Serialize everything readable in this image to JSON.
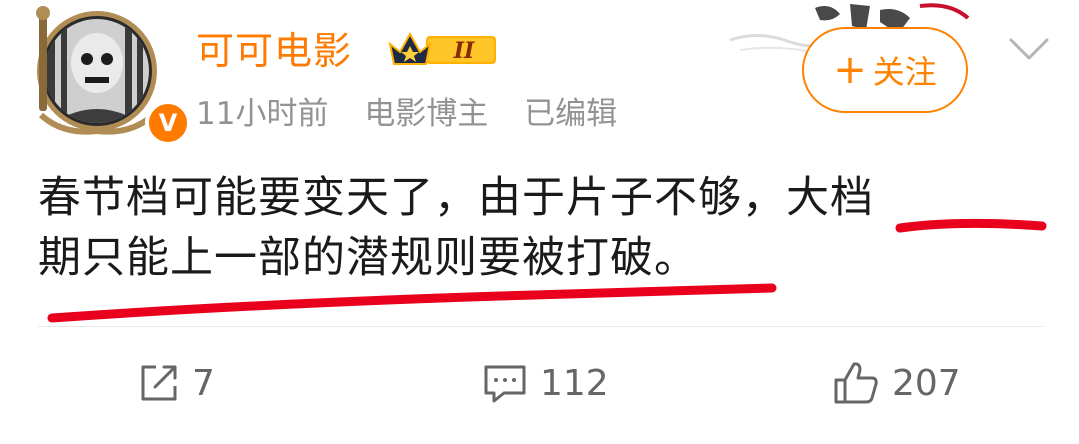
{
  "post": {
    "author": "可可电影",
    "vip_level": "II",
    "verified_mark": "V",
    "meta": {
      "time": "11小时前",
      "role": "电影博主",
      "edited": "已编辑"
    },
    "follow_label": "关注",
    "content": {
      "part1": "春节档可能要变天了，由于片子不够，",
      "highlight_line1": "大档",
      "highlight_line2": "期只能上一部的潜规则要被打破",
      "end": "。"
    },
    "actions": {
      "repost_count": "7",
      "comment_count": "112",
      "like_count": "207"
    }
  },
  "colors": {
    "accent": "#ff8200",
    "annotation": "#e8001c",
    "meta_text": "#939393"
  }
}
